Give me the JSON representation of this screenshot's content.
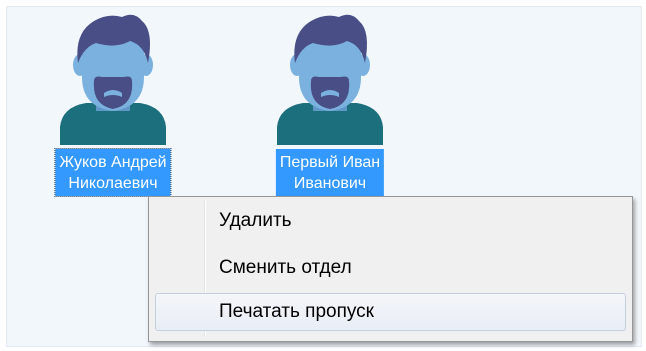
{
  "users": [
    {
      "name_line1": "Жуков Андрей",
      "name_line2": "Николаевич",
      "icon": "user-avatar-icon"
    },
    {
      "name_line1": "Первый Иван",
      "name_line2": "Иванович",
      "icon": "user-avatar-icon"
    }
  ],
  "context_menu": {
    "items": [
      {
        "label": "Удалить"
      },
      {
        "label": "Сменить отдел"
      },
      {
        "label": "Печатать пропуск",
        "highlighted": true
      }
    ]
  },
  "colors": {
    "selection": "#3399ff",
    "panel_background": "#f2f7fc",
    "avatar_hair": "#4a4e86",
    "avatar_skin": "#7ab1df",
    "avatar_shirt": "#1c6f7c",
    "menu_background": "#f0f0f0"
  }
}
